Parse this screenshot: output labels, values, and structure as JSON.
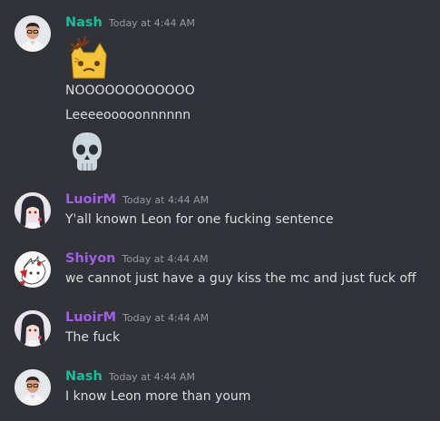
{
  "colors": {
    "background": "#313338",
    "nash": "#1abc9c",
    "luoirm": "#a25ee8",
    "shiyon": "#a25ee8",
    "text": "#dbdee1",
    "timestamp": "#949ba4"
  },
  "messages": [
    {
      "author": "Nash",
      "timestamp": "Today at 4:44 AM",
      "avatar_icon": "man-with-glasses-avatar",
      "emoji_icon": "crying-cat-emoji",
      "lines": [
        "NOOOOOOOOOOOO",
        "Leeeeooooonnnnnn"
      ],
      "emoji2_icon": "skull-emoji"
    },
    {
      "author": "LuoirM",
      "timestamp": "Today at 4:44 AM",
      "avatar_icon": "anime-girl-avatar",
      "lines": [
        "Y'all known Leon for one fucking sentence"
      ]
    },
    {
      "author": "Shiyon",
      "timestamp": "Today at 4:44 AM",
      "avatar_icon": "anime-sketch-avatar",
      "lines": [
        "we cannot just have a guy kiss the mc and just fuck off"
      ]
    },
    {
      "author": "LuoirM",
      "timestamp": "Today at 4:44 AM",
      "avatar_icon": "anime-girl-avatar",
      "lines": [
        "The fuck"
      ]
    },
    {
      "author": "Nash",
      "timestamp": "Today at 4:44 AM",
      "avatar_icon": "man-with-glasses-avatar",
      "lines": [
        "I know Leon more than youm"
      ]
    }
  ]
}
